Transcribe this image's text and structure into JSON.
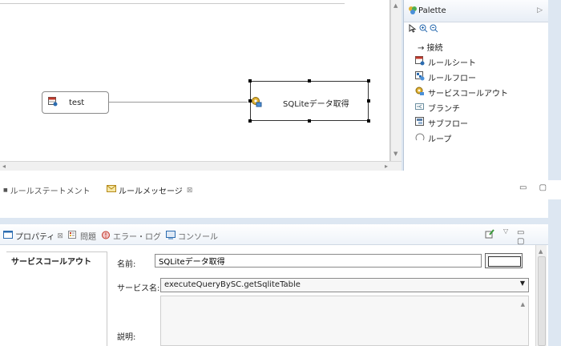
{
  "canvas": {
    "nodes": [
      {
        "label": "test"
      },
      {
        "label": "SQLiteデータ取得"
      }
    ]
  },
  "palette": {
    "title": "Palette",
    "items": [
      {
        "label": "→ 接続",
        "icon": "arrow-icon"
      },
      {
        "label": "ルールシート",
        "icon": "rulesheet-icon",
        "color": "#c0392b"
      },
      {
        "label": "ルールフロー",
        "icon": "ruleflow-icon",
        "color": "#2b6cb0"
      },
      {
        "label": "サービスコールアウト",
        "icon": "service-callout-icon",
        "color": "#d4a017"
      },
      {
        "label": "ブランチ",
        "icon": "branch-icon",
        "color": "#6b8e9f"
      },
      {
        "label": "サブフロー",
        "icon": "subflow-icon",
        "color": "#5a7fa8"
      },
      {
        "label": "ループ",
        "icon": "loop-icon",
        "color": "#888888"
      }
    ]
  },
  "message_tabs": {
    "rule_statement": "ルールステートメント",
    "rule_message": "ルールメッセージ"
  },
  "properties_tabs": {
    "properties": "プロパティ",
    "problems": "問題",
    "error_log": "エラー・ログ",
    "console": "コンソール"
  },
  "properties": {
    "side_tab": "サービスコールアウト",
    "name_label": "名前:",
    "name_value": "SQLiteデータ取得",
    "service_label": "サービス名:",
    "service_value": "executeQueryBySC.getSqliteTable",
    "description_label": "説明:"
  },
  "colors": {
    "accent": "#dde7f2",
    "selection": "#000000"
  }
}
